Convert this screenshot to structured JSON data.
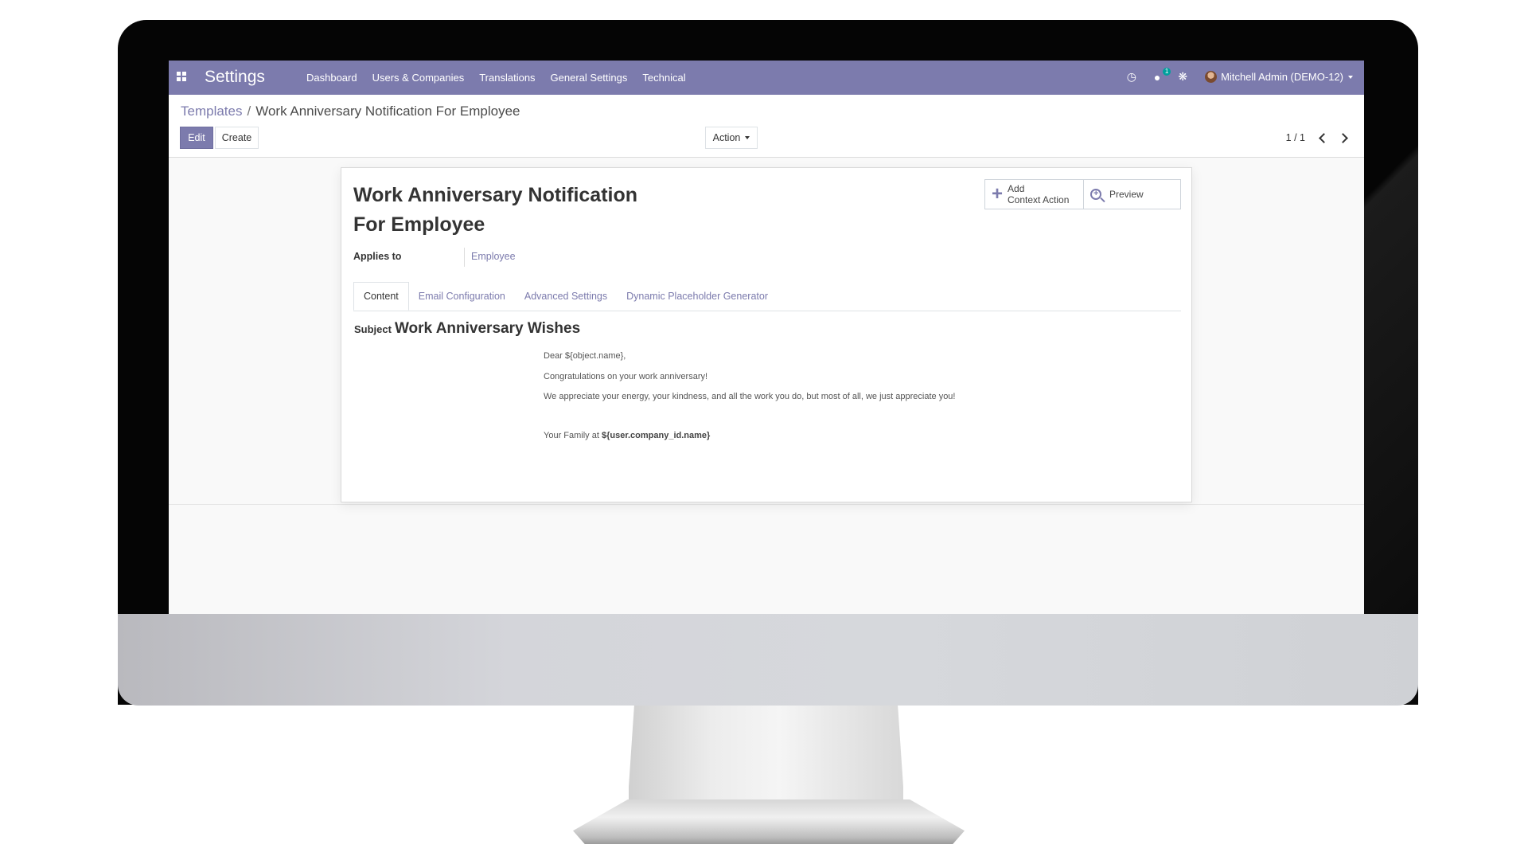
{
  "navbar": {
    "brand": "Settings",
    "menu": [
      "Dashboard",
      "Users & Companies",
      "Translations",
      "General Settings",
      "Technical"
    ],
    "chat_badge": "1",
    "user": "Mitchell Admin (DEMO-12)",
    "color": "#7c7bad"
  },
  "control_panel": {
    "breadcrumb_parent": "Templates",
    "breadcrumb_separator": "/",
    "breadcrumb_current": "Work Anniversary Notification For Employee",
    "edit_label": "Edit",
    "create_label": "Create",
    "action_label": "Action",
    "pager": "1 / 1"
  },
  "form": {
    "title_line1": "Work Anniversary Notification",
    "title_line2": "For Employee",
    "smart_buttons": {
      "add_line1": "Add",
      "add_line2": "Context Action",
      "preview": "Preview"
    },
    "applies_to_label": "Applies to",
    "applies_to_value": "Employee",
    "tabs": [
      "Content",
      "Email Configuration",
      "Advanced Settings",
      "Dynamic Placeholder Generator"
    ],
    "subject_label": "Subject",
    "subject_value": "Work Anniversary Wishes",
    "body": {
      "greeting": "Dear ${object.name},",
      "line1": "Congratulations on your work anniversary!",
      "line2": "We appreciate your energy, your kindness, and all the work you do, but most of all, we just appreciate you!",
      "signature_prefix": "Your Family at",
      "signature_company": "${user.company_id.name}"
    }
  }
}
